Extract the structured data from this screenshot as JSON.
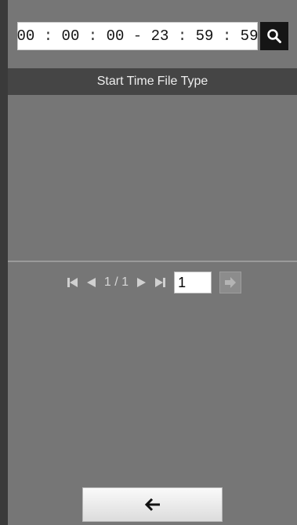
{
  "time_range": {
    "start_h": "00",
    "start_m": "00",
    "start_s": "00",
    "range_sep": "-",
    "end_h": "23",
    "end_m": "59",
    "end_s": "59",
    "colon": ":"
  },
  "search": {
    "icon": "search-icon"
  },
  "table": {
    "columns": [
      "Start Time",
      "File Type"
    ]
  },
  "pager": {
    "page_info": "1 / 1",
    "page_input_value": "1",
    "icons": [
      "first-page-icon",
      "prev-page-icon",
      "next-page-icon",
      "last-page-icon",
      "go-arrow-icon"
    ]
  },
  "back_button": {
    "icon": "back-arrow-icon"
  },
  "colors": {
    "panel_bg": "#767676",
    "header_bg": "#454545",
    "search_button_bg": "#151515",
    "button_gradient_top": "#fafafa"
  }
}
